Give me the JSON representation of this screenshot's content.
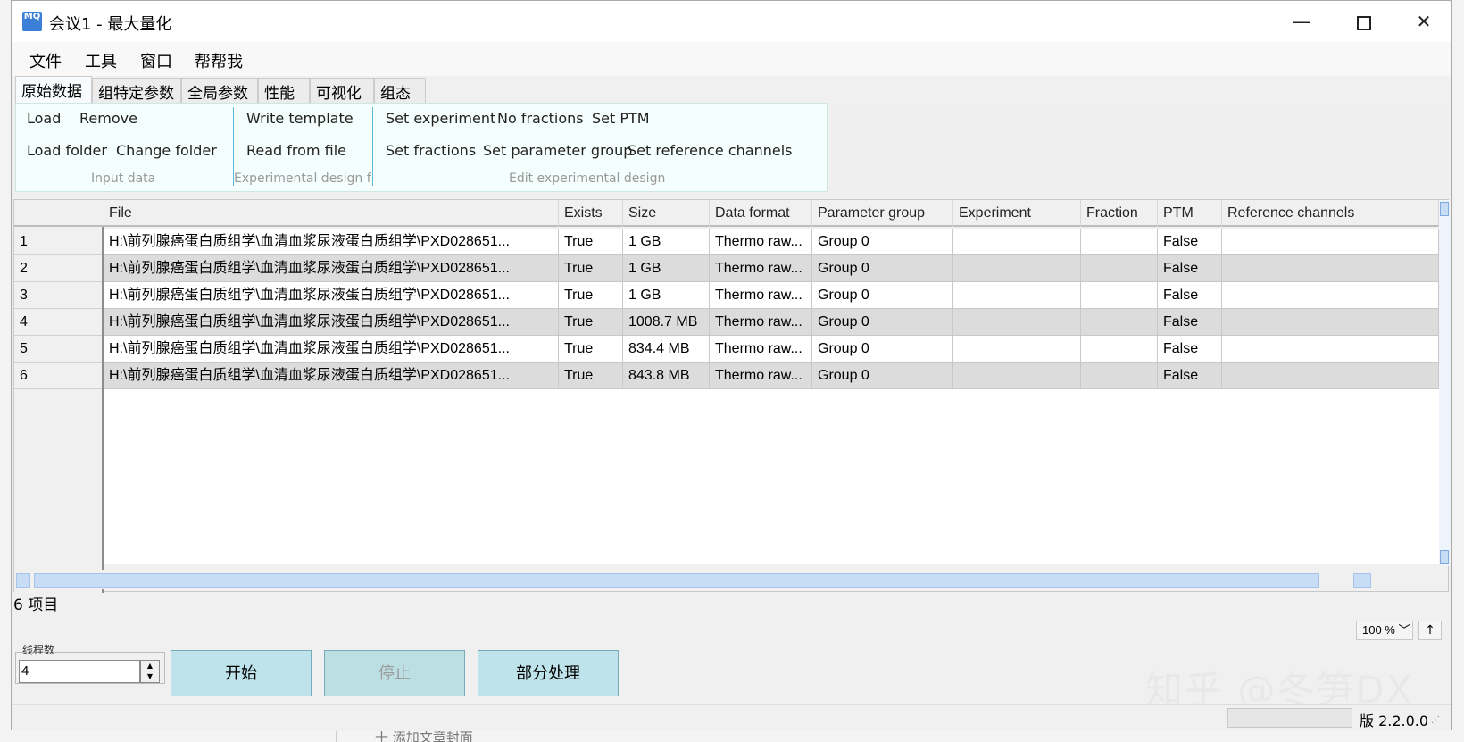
{
  "window": {
    "title": "会议1 - 最大量化",
    "icon_text": "MQ"
  },
  "menu": [
    "文件",
    "工具",
    "窗口",
    "帮帮我"
  ],
  "tabs": [
    "原始数据",
    "组特定参数",
    "全局参数",
    "性能",
    "可视化",
    "组态"
  ],
  "ribbon": {
    "input_data": {
      "load": "Load",
      "remove": "Remove",
      "load_folder": "Load folder",
      "change_folder": "Change folder",
      "caption": "Input data"
    },
    "experimental_design_file": {
      "write_template": "Write template",
      "read_from_file": "Read from file",
      "caption": "Experimental design file"
    },
    "edit_experimental_design": {
      "set_experiment": "Set experiment",
      "no_fractions": "No fractions",
      "set_ptm": "Set PTM",
      "set_fractions": "Set fractions",
      "set_parameter_group": "Set parameter group",
      "set_reference_channels": "Set reference channels",
      "caption": "Edit experimental design"
    }
  },
  "table": {
    "columns": [
      "File",
      "Exists",
      "Size",
      "Data format",
      "Parameter group",
      "Experiment",
      "Fraction",
      "PTM",
      "Reference channels"
    ],
    "rows": [
      {
        "n": "1",
        "file": "H:\\前列腺癌蛋白质组学\\血清血浆尿液蛋白质组学\\PXD028651...",
        "exists": "True",
        "size": "1 GB",
        "format": "Thermo raw...",
        "group": "Group 0",
        "experiment": "",
        "fraction": "",
        "ptm": "False",
        "ref": ""
      },
      {
        "n": "2",
        "file": "H:\\前列腺癌蛋白质组学\\血清血浆尿液蛋白质组学\\PXD028651...",
        "exists": "True",
        "size": "1 GB",
        "format": "Thermo raw...",
        "group": "Group 0",
        "experiment": "",
        "fraction": "",
        "ptm": "False",
        "ref": ""
      },
      {
        "n": "3",
        "file": "H:\\前列腺癌蛋白质组学\\血清血浆尿液蛋白质组学\\PXD028651...",
        "exists": "True",
        "size": "1 GB",
        "format": "Thermo raw...",
        "group": "Group 0",
        "experiment": "",
        "fraction": "",
        "ptm": "False",
        "ref": ""
      },
      {
        "n": "4",
        "file": "H:\\前列腺癌蛋白质组学\\血清血浆尿液蛋白质组学\\PXD028651...",
        "exists": "True",
        "size": "1008.7 MB",
        "format": "Thermo raw...",
        "group": "Group 0",
        "experiment": "",
        "fraction": "",
        "ptm": "False",
        "ref": ""
      },
      {
        "n": "5",
        "file": "H:\\前列腺癌蛋白质组学\\血清血浆尿液蛋白质组学\\PXD028651...",
        "exists": "True",
        "size": "834.4 MB",
        "format": "Thermo raw...",
        "group": "Group 0",
        "experiment": "",
        "fraction": "",
        "ptm": "False",
        "ref": ""
      },
      {
        "n": "6",
        "file": "H:\\前列腺癌蛋白质组学\\血清血浆尿液蛋白质组学\\PXD028651...",
        "exists": "True",
        "size": "843.8 MB",
        "format": "Thermo raw...",
        "group": "Group 0",
        "experiment": "",
        "fraction": "",
        "ptm": "False",
        "ref": ""
      }
    ]
  },
  "status": {
    "items_count": "6 项目",
    "zoom": "100 %",
    "zoom_chevron": "﹀",
    "up_arrow": "↑"
  },
  "controls": {
    "threads_label": "线程数",
    "threads_value": "4",
    "start": "开始",
    "stop": "停止",
    "partial": "部分处理"
  },
  "watermark": "知乎 @冬笋DX",
  "version": "版 2.2.0.0",
  "background": {
    "bottom_text": "十 添加文章封面"
  }
}
